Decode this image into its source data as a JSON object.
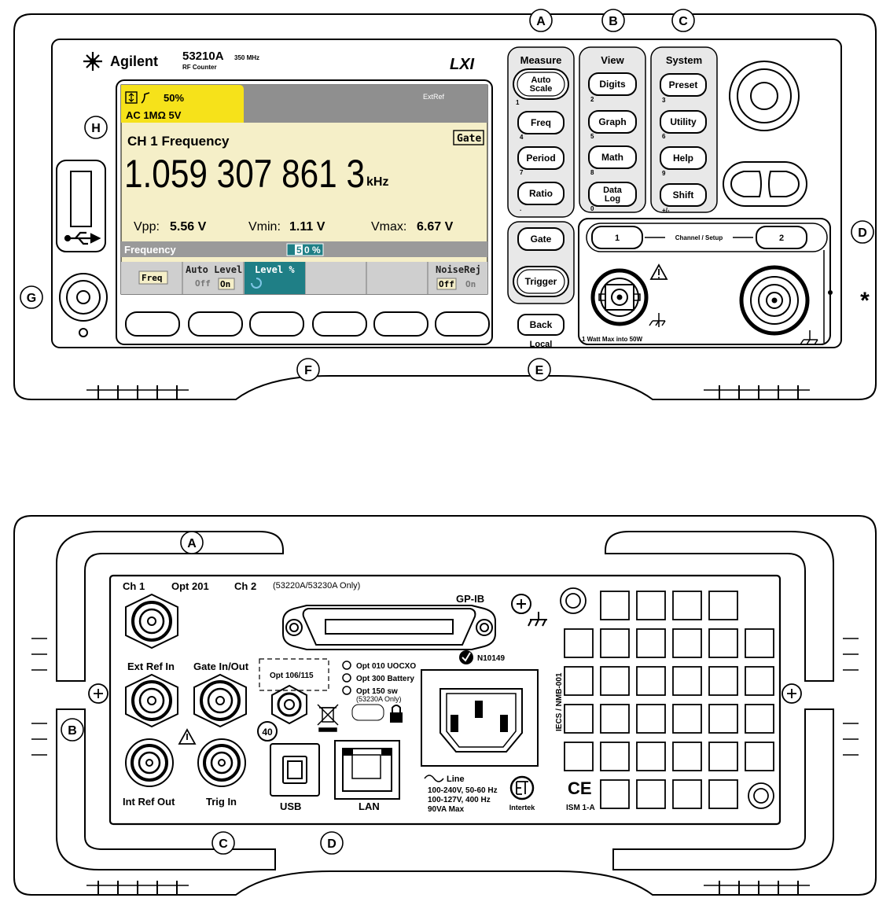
{
  "callouts": {
    "front": {
      "A": "A",
      "B": "B",
      "C": "C",
      "D": "D",
      "E": "E",
      "F": "F",
      "G": "G",
      "H": "H",
      "star": "*"
    },
    "rear": {
      "A": "A",
      "B": "B",
      "C": "C",
      "D": "D"
    }
  },
  "front": {
    "brand": "Agilent",
    "model": "53210A",
    "model_freq": "350 MHz",
    "model_desc": "RF Counter",
    "lxi": "LXI",
    "screen": {
      "status_pct": "50%",
      "status_input": "AC 1MΩ  5V",
      "extref": "ExtRef",
      "title": "CH 1 Frequency",
      "gate_badge": "Gate",
      "reading": "1.059 307 861 3",
      "reading_unit": "kHz",
      "vpp_label": "Vpp:",
      "vpp_value": "5.56 V",
      "vmin_label": "Vmin:",
      "vmin_value": "1.11 V",
      "vmax_label": "Vmax:",
      "vmax_value": "6.67 V",
      "param_label": "Frequency",
      "param_value_hi": "5",
      "param_value_rest": "0 %",
      "softkeys": {
        "freq": "Freq",
        "auto_level": "Auto Level",
        "auto_level_off": "Off",
        "auto_level_on": "On",
        "level_pct": "Level %",
        "noise_rej": "NoiseRej",
        "noise_off": "Off",
        "noise_on": "On"
      }
    },
    "groups": {
      "measure": "Measure",
      "view": "View",
      "system": "System"
    },
    "keys": {
      "auto_scale_1": "Auto",
      "auto_scale_2": "Scale",
      "freq": "Freq",
      "period": "Period",
      "ratio": "Ratio",
      "digits": "Digits",
      "graph": "Graph",
      "math": "Math",
      "data_log_1": "Data",
      "data_log_2": "Log",
      "preset": "Preset",
      "utility": "Utility",
      "help": "Help",
      "shift": "Shift",
      "gate": "Gate",
      "trigger": "Trigger",
      "back": "Back",
      "local": "Local",
      "ch1": "1",
      "ch2": "2",
      "channel_setup": "Channel / Setup"
    },
    "key_numbers": {
      "n1": "1",
      "n2": "2",
      "n3": "3",
      "n4": "4",
      "n5": "5",
      "n6": "6",
      "n7": "7",
      "n8": "8",
      "n9": "9",
      "n0": "0",
      "dot": ".",
      "pm": "+/-"
    },
    "input_note": "1 Watt Max into 50W"
  },
  "rear": {
    "ch1": "Ch 1",
    "opt201": "Opt 201",
    "ch2": "Ch 2",
    "ch2_note": "(53220A/53230A Only)",
    "gpib": "GP-IB",
    "ext_ref_in": "Ext Ref In",
    "gate_in_out": "Gate In/Out",
    "opt106": "Opt 106/115",
    "opt010": "Opt 010 UOCXO",
    "opt300": "Opt 300 Battery",
    "opt150": "Opt 150 sw",
    "opt150_note": "(53230A Only)",
    "n10149": "N10149",
    "int_ref_out": "Int Ref Out",
    "trig_in": "Trig In",
    "usb": "USB",
    "lan": "LAN",
    "line": "Line",
    "line1": "100-240V, 50-60 Hz",
    "line2": "100-127V, 400 Hz",
    "line3": "90VA Max",
    "intertek": "Intertek",
    "iecs": "IECS / NMB-001",
    "ce": "CE",
    "ism": "ISM 1-A",
    "forty": "40"
  },
  "colors": {
    "status_yellow": "#f6e21a",
    "screen_bg": "#f5efc8",
    "teal": "#1f7f86",
    "gray_bar": "#8f8f8f",
    "softkey_bg": "#cfcfcf",
    "panel_gray": "#e8e8e8"
  }
}
